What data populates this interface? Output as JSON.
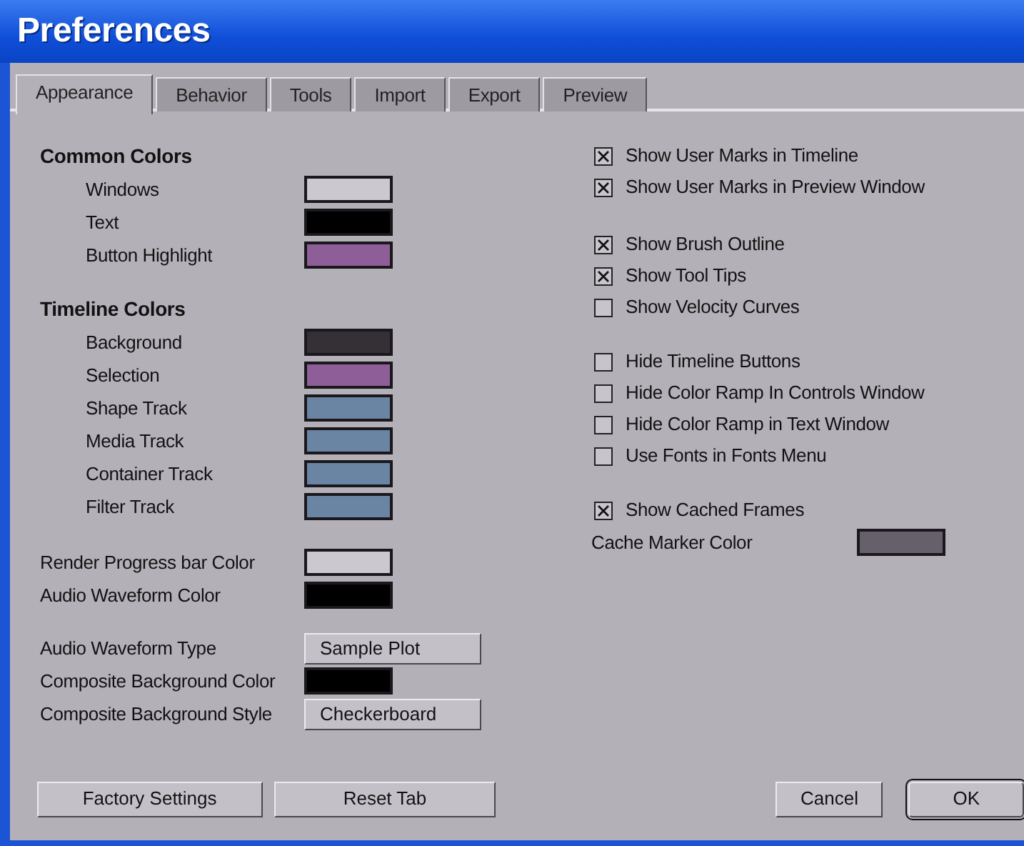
{
  "window": {
    "title": "Preferences"
  },
  "tabs": [
    {
      "label": "Appearance",
      "selected": true
    },
    {
      "label": "Behavior",
      "selected": false
    },
    {
      "label": "Tools",
      "selected": false
    },
    {
      "label": "Import",
      "selected": false
    },
    {
      "label": "Export",
      "selected": false
    },
    {
      "label": "Preview",
      "selected": false
    }
  ],
  "color_groups": [
    {
      "heading": "Common Colors",
      "items": [
        {
          "label": "Windows",
          "color": "#ccc8d0"
        },
        {
          "label": "Text",
          "color": "#000000"
        },
        {
          "label": "Button Highlight",
          "color": "#8e5e98"
        }
      ]
    },
    {
      "heading": "Timeline Colors",
      "items": [
        {
          "label": "Background",
          "color": "#343036"
        },
        {
          "label": "Selection",
          "color": "#8e5e98"
        },
        {
          "label": "Shape Track",
          "color": "#6a84a4"
        },
        {
          "label": "Media Track",
          "color": "#6a84a4"
        },
        {
          "label": "Container Track",
          "color": "#6a84a4"
        },
        {
          "label": "Filter Track",
          "color": "#6a84a4"
        }
      ]
    }
  ],
  "settings": [
    [
      {
        "kind": "color",
        "label": "Render Progress bar Color",
        "color": "#ccc8d0"
      },
      {
        "kind": "color",
        "label": "Audio Waveform Color",
        "color": "#000000"
      }
    ],
    [
      {
        "kind": "choice",
        "label": "Audio Waveform Type",
        "value": "Sample Plot"
      },
      {
        "kind": "color",
        "label": "Composite Background Color",
        "color": "#000000"
      },
      {
        "kind": "choice",
        "label": "Composite Background Style",
        "value": "Checkerboard"
      }
    ]
  ],
  "option_groups": [
    [
      {
        "label": "Show User Marks in Timeline",
        "checked": true
      },
      {
        "label": "Show User Marks in Preview Window",
        "checked": true
      }
    ],
    [
      {
        "label": "Show Brush Outline",
        "checked": true
      },
      {
        "label": "Show Tool Tips",
        "checked": true
      },
      {
        "label": "Show Velocity Curves",
        "checked": false
      }
    ],
    [
      {
        "label": "Hide Timeline Buttons",
        "checked": false
      },
      {
        "label": "Hide Color Ramp In Controls Window",
        "checked": false
      },
      {
        "label": "Hide Color Ramp in Text Window",
        "checked": false
      },
      {
        "label": "Use Fonts in Fonts Menu",
        "checked": false
      }
    ],
    [
      {
        "label": "Show Cached Frames",
        "checked": true
      }
    ]
  ],
  "cache_marker": {
    "label": "Cache Marker Color",
    "color": "#66606a"
  },
  "buttons": [
    {
      "label": "Factory Settings",
      "kind": "left"
    },
    {
      "label": "Reset Tab",
      "kind": "left"
    },
    {
      "label": "Cancel",
      "kind": "right"
    },
    {
      "label": "OK",
      "kind": "default"
    }
  ]
}
